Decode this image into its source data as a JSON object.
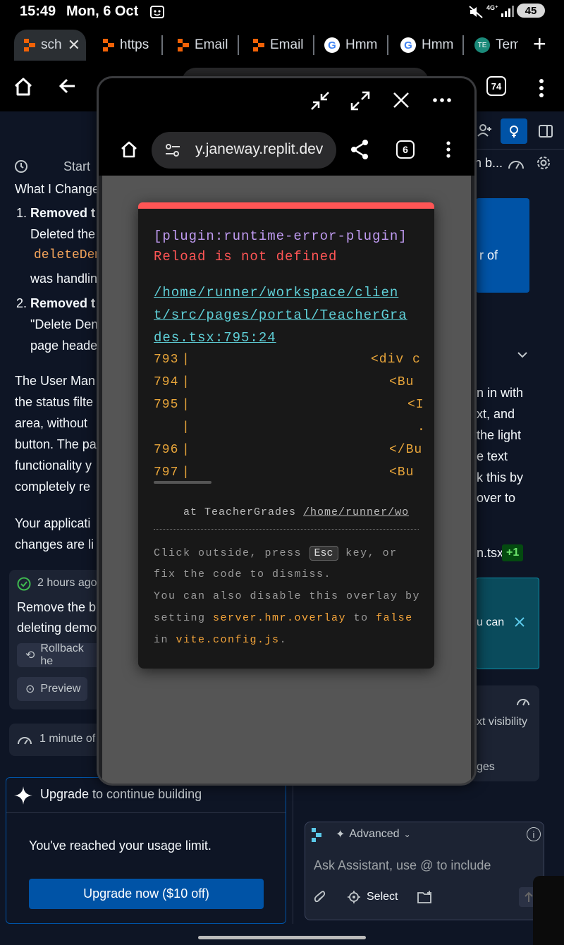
{
  "status_bar": {
    "time": "15:49",
    "date": "Mon, 6 Oct",
    "battery": "45"
  },
  "tabs": [
    {
      "label": "sch",
      "icon": "replit-icon",
      "active": true
    },
    {
      "label": "https",
      "icon": "replit-icon"
    },
    {
      "label": "Email",
      "icon": "replit-icon"
    },
    {
      "label": "Email",
      "icon": "replit-icon"
    },
    {
      "label": "Hmm",
      "icon": "google-icon"
    },
    {
      "label": "Hmm",
      "icon": "google-icon"
    },
    {
      "label": "Tem",
      "icon": "tem-icon"
    }
  ],
  "toolbar": {
    "tab_count": "74"
  },
  "workspace": {
    "name": "scho",
    "start_label": "Start"
  },
  "chat": {
    "heading": "What I Change",
    "item1_num": "1.",
    "item1_bold": "Removed t",
    "item1_line1": "Deleted the",
    "item1_code": "deleteDem",
    "item1_line3": "was handlin",
    "item2_num": "2.",
    "item2_bold": "Removed t",
    "item2_line1": "\"Delete Dem",
    "item2_line2": "page heade",
    "para1": [
      "The User Man",
      "the status filte",
      "area, without",
      "button. The pa",
      "functionality y",
      "completely re"
    ],
    "para2": [
      "Your applicati",
      "changes are li"
    ],
    "checkpoint_time": "2 hours ago",
    "checkpoint_text": [
      "Remove the b",
      "deleting demo"
    ],
    "rollback_label": "Rollback he",
    "preview_label": "Preview",
    "recent_time": "1 minute of"
  },
  "upgrade": {
    "title_bold": "Upgrade",
    "title_rest": " to continue building",
    "limit_text": "You've reached your usage limit.",
    "button_label": "Upgrade now ($10 off)"
  },
  "right_pane": {
    "header_text": "n b...",
    "blue_text": "r of",
    "para": [
      "n in with",
      "xt, and",
      "the light",
      "e text",
      "k this by",
      "over to"
    ],
    "file_label": "n.tsx",
    "file_badge": "+1",
    "teal_text": "u can",
    "card_text": [
      "xt visibility",
      "ges"
    ],
    "agent_mode": "Advanced",
    "input_placeholder": "Ask Assistant, use @ to include",
    "select_label": "Select"
  },
  "popup": {
    "url": "y.janeway.replit.dev",
    "tab_count": "6"
  },
  "overlay": {
    "plugin": "[plugin:runtime-error-plugin]",
    "message": "Reload is not defined",
    "file_lines": [
      "/home/runner/workspace/clien",
      "t/src/pages/portal/TeacherGra",
      "des.tsx:795:24"
    ],
    "code_lines": [
      {
        "num": "793",
        "code": "<div c"
      },
      {
        "num": "794",
        "code": "<Bu"
      },
      {
        "num": "795",
        "code": "<I"
      },
      {
        "num": "",
        "code": "."
      },
      {
        "num": "796",
        "code": "</Bu"
      },
      {
        "num": "797",
        "code": "<Bu"
      }
    ],
    "stack_prefix": "at TeacherGrades",
    "stack_path": "/home/runner/wo",
    "tip_l1a": "Click outside, press",
    "tip_esc": "Esc",
    "tip_l1b": "key, or",
    "tip_l2": "fix the code to dismiss.",
    "tip_l3": "You can also disable this overlay by",
    "tip_l4a": "setting",
    "tip_l4b": "server.hmr.overlay",
    "tip_l4c": "to",
    "tip_l4d": "false",
    "tip_l5a": "in",
    "tip_l5b": "vite.config.js",
    "tip_l5c": "."
  },
  "colors": {
    "accent": "#0053a6",
    "error": "#ff5555",
    "replit_orange": "#f26207"
  }
}
